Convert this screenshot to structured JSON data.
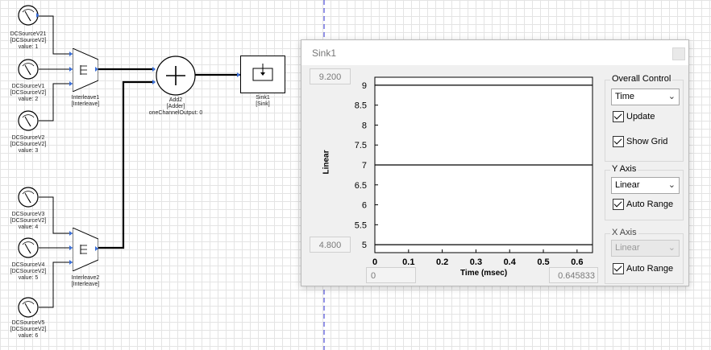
{
  "canvas": {
    "sources": [
      {
        "name": "DCSourceV21",
        "type": "[DCSourceV2]",
        "value": "value: 1"
      },
      {
        "name": "DCSourceV1",
        "type": "[DCSourceV2]",
        "value": "value: 2"
      },
      {
        "name": "DCSourceV2",
        "type": "[DCSourceV2]",
        "value": "value: 3"
      },
      {
        "name": "DCSourceV3",
        "type": "[DCSourceV2]",
        "value": "value: 4"
      },
      {
        "name": "DCSourceV4",
        "type": "[DCSourceV2]",
        "value": "value: 5"
      },
      {
        "name": "DCSourceV5",
        "type": "[DCSourceV2]",
        "value": "value: 6"
      }
    ],
    "interleave1": {
      "name": "Interleave1",
      "type": "[Interleave]"
    },
    "interleave2": {
      "name": "Interleave2",
      "type": "[Interleave]"
    },
    "adder": {
      "name": "Add2",
      "type": "[Adder]",
      "param": "oneChannelOutput: 0"
    },
    "sink": {
      "name": "Sink1",
      "type": "[Sink]"
    }
  },
  "sink_window": {
    "title": "Sink1",
    "y_max": "9.200",
    "y_min": "4.800",
    "x_min": "0",
    "x_max": "0.645833",
    "y_axis_label": "Linear",
    "x_axis_label": "Time (msec)",
    "overall_control": {
      "title": "Overall Control",
      "mode": "Time",
      "update_label": "Update",
      "update_checked": true,
      "show_grid_label": "Show Grid",
      "show_grid_checked": true
    },
    "y_axis_group": {
      "title": "Y Axis",
      "scale": "Linear",
      "auto_range_label": "Auto Range",
      "auto_range_checked": true
    },
    "x_axis_group": {
      "title": "X Axis",
      "scale": "Linear",
      "auto_range_label": "Auto Range",
      "auto_range_checked": true
    }
  },
  "chart_data": {
    "type": "line",
    "xlabel": "Time (msec)",
    "ylabel": "Linear",
    "xlim": [
      0,
      0.645833
    ],
    "ylim": [
      4.8,
      9.2
    ],
    "x_ticks": [
      "0",
      "0.1",
      "0.2",
      "0.3",
      "0.4",
      "0.5",
      "0.6"
    ],
    "y_ticks": [
      "5",
      "5.5",
      "6",
      "6.5",
      "7",
      "7.5",
      "8",
      "8.5",
      "9"
    ],
    "series": [
      {
        "x": [
          0,
          0.645833
        ],
        "values": [
          9,
          9
        ]
      },
      {
        "x": [
          0,
          0.645833
        ],
        "values": [
          7,
          7
        ]
      },
      {
        "x": [
          0,
          0.645833
        ],
        "values": [
          5,
          5
        ]
      }
    ]
  }
}
